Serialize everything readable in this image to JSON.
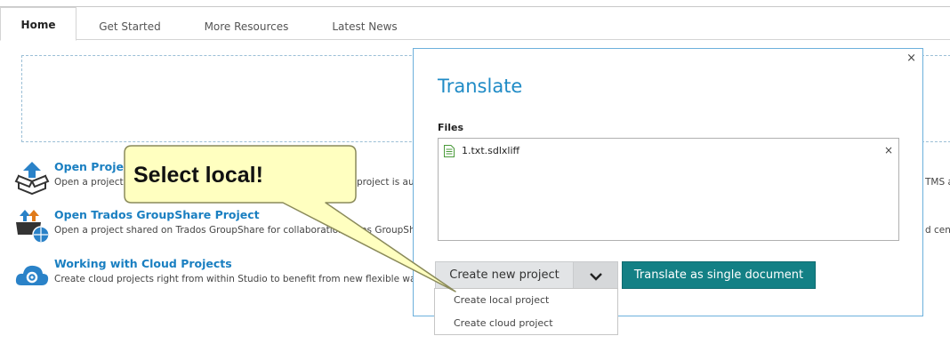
{
  "tabs": [
    {
      "label": "Home"
    },
    {
      "label": "Get Started"
    },
    {
      "label": "More Resources"
    },
    {
      "label": "Latest News"
    }
  ],
  "home_items": [
    {
      "title": "Open Proje",
      "description": "Open a project",
      "description_tail": "project is aut",
      "right_cut": "TMS a",
      "icon": "open-project-icon"
    },
    {
      "title": "Open Trados GroupShare Project",
      "description": "Open a project shared on Trados GroupShare for collaboration",
      "description_tail": "ados GroupSh",
      "right_cut": "d cent",
      "icon": "groupshare-icon"
    },
    {
      "title": "Working with Cloud Projects",
      "description": "Create cloud projects right from within Studio to benefit from new flexible ways",
      "icon": "cloud-icon"
    }
  ],
  "dialog": {
    "title": "Translate",
    "close": "×",
    "files_label": "Files",
    "files": [
      {
        "name": "1.txt.sdlxliff",
        "remove": "×"
      }
    ],
    "create_button": "Create new project",
    "translate_button": "Translate as single document"
  },
  "menu": {
    "items": [
      {
        "label": "Create local project"
      },
      {
        "label": "Create cloud project"
      }
    ]
  },
  "callout": {
    "text": "Select local!"
  },
  "colors": {
    "accent": "#1f8bc6",
    "primary_button": "#138085",
    "callout_fill": "#ffffc0"
  }
}
